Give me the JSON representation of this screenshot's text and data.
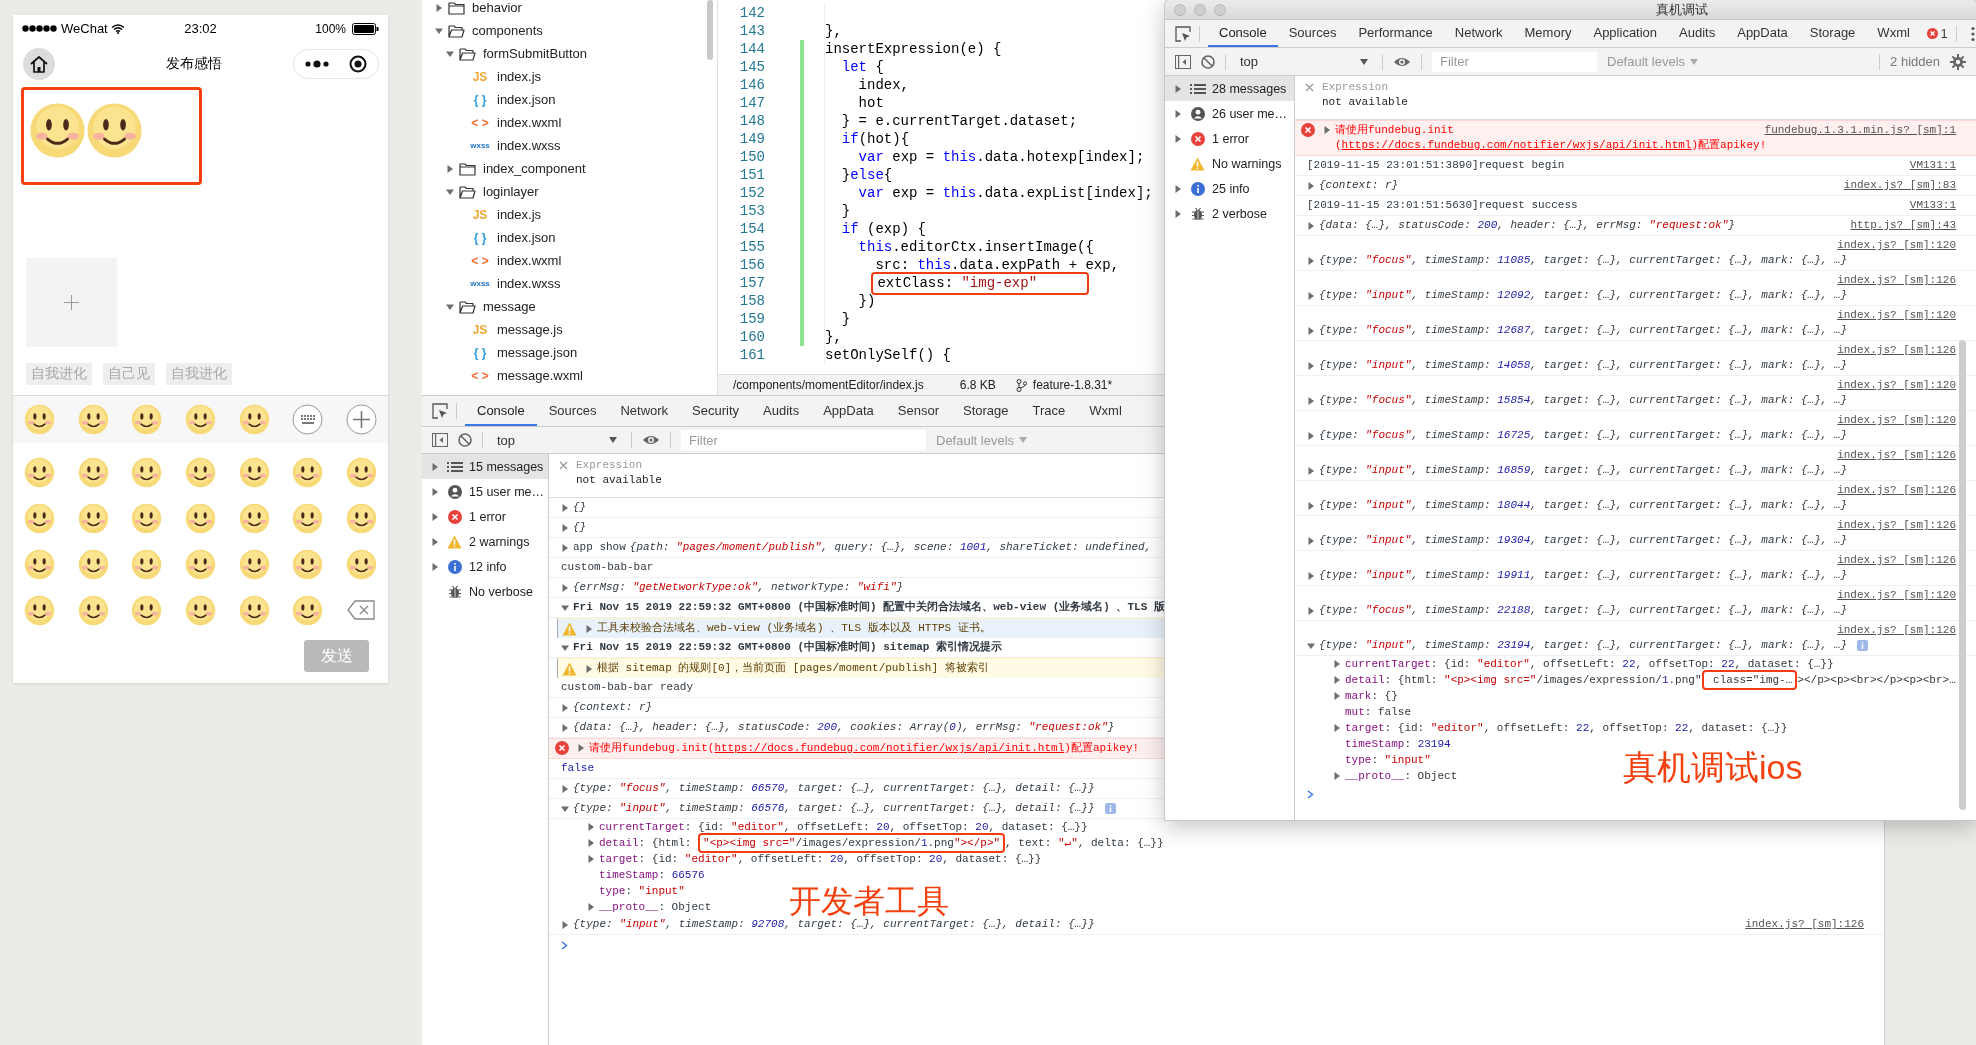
{
  "simulator": {
    "carrier": "WeChat",
    "time": "23:02",
    "battery": "100%",
    "title": "发布感悟",
    "content": [
      {
        "kind": "smiley"
      },
      {
        "kind": "smiley"
      }
    ],
    "tags": [
      "自我进化",
      "自己见",
      "自我进化"
    ],
    "toolbar": [
      {
        "kind": "smiley"
      },
      {
        "kind": "smiley"
      },
      {
        "kind": "smiley"
      },
      {
        "kind": "smiley"
      },
      {
        "kind": "smiley"
      },
      {
        "kind": "keyboard"
      },
      {
        "kind": "add"
      }
    ],
    "emojis": [
      {
        "kind": "smiley"
      },
      {
        "kind": "smiley"
      },
      {
        "kind": "smiley"
      },
      {
        "kind": "smiley"
      },
      {
        "kind": "smiley"
      },
      {
        "kind": "smiley"
      },
      {
        "kind": "smiley"
      },
      {
        "kind": "smiley"
      },
      {
        "kind": "smiley"
      },
      {
        "kind": "smiley"
      },
      {
        "kind": "smiley"
      },
      {
        "kind": "smiley"
      },
      {
        "kind": "smiley"
      },
      {
        "kind": "smiley"
      },
      {
        "kind": "smiley"
      },
      {
        "kind": "smiley"
      },
      {
        "kind": "smiley"
      },
      {
        "kind": "smiley"
      },
      {
        "kind": "smiley"
      },
      {
        "kind": "smiley"
      },
      {
        "kind": "smiley"
      },
      {
        "kind": "smiley"
      },
      {
        "kind": "smiley"
      },
      {
        "kind": "smiley"
      },
      {
        "kind": "smiley"
      },
      {
        "kind": "smiley"
      },
      {
        "kind": "smiley"
      },
      {
        "kind": "delete"
      }
    ],
    "send_button": {
      "label": "发送",
      "disabled": true
    }
  },
  "explorer": {
    "items": [
      {
        "label": "behavior",
        "kind": "folder",
        "expanded": false
      },
      {
        "label": "components",
        "kind": "folder",
        "expanded": true,
        "children": [
          {
            "label": "formSubmitButton",
            "kind": "folder",
            "expanded": true,
            "children": [
              {
                "label": "index.js",
                "kind": "js",
                "icon": "JS"
              },
              {
                "label": "index.json",
                "kind": "json",
                "icon": "{ }"
              },
              {
                "label": "index.wxml",
                "kind": "wxml",
                "icon": "< >"
              },
              {
                "label": "index.wxss",
                "kind": "wxss",
                "icon": "wxss"
              }
            ]
          },
          {
            "label": "index_component",
            "kind": "folder",
            "expanded": false
          },
          {
            "label": "loginlayer",
            "kind": "folder",
            "expanded": true,
            "children": [
              {
                "label": "index.js",
                "kind": "js",
                "icon": "JS"
              },
              {
                "label": "index.json",
                "kind": "json",
                "icon": "{ }"
              },
              {
                "label": "index.wxml",
                "kind": "wxml",
                "icon": "< >"
              },
              {
                "label": "index.wxss",
                "kind": "wxss",
                "icon": "wxss"
              }
            ]
          },
          {
            "label": "message",
            "kind": "folder",
            "expanded": true,
            "children": [
              {
                "label": "message.js",
                "kind": "js",
                "icon": "JS"
              },
              {
                "label": "message.json",
                "kind": "json",
                "icon": "{ }"
              },
              {
                "label": "message.wxml",
                "kind": "wxml",
                "icon": "< >"
              }
            ]
          }
        ]
      }
    ]
  },
  "editor": {
    "lines": [
      {
        "num": "142",
        "changed": false
      },
      {
        "num": "143",
        "changed": false,
        "parts": [
          {
            "text": "},"
          }
        ]
      },
      {
        "num": "144",
        "changed": true,
        "parts": [
          {
            "text": "insertExpression(e) {"
          }
        ]
      },
      {
        "num": "145",
        "changed": true,
        "parts": [
          {
            "kind": "keyword",
            "text": "  let"
          },
          {
            "text": " {"
          }
        ]
      },
      {
        "num": "146",
        "changed": true,
        "parts": [
          {
            "text": "    index,"
          }
        ]
      },
      {
        "num": "147",
        "changed": true,
        "parts": [
          {
            "text": "    hot"
          }
        ]
      },
      {
        "num": "148",
        "changed": true,
        "parts": [
          {
            "text": "  } = e.currentTarget.dataset;"
          }
        ]
      },
      {
        "num": "149",
        "changed": true,
        "parts": [
          {
            "kind": "keyword",
            "text": "  if"
          },
          {
            "text": "(hot){"
          }
        ]
      },
      {
        "num": "150",
        "changed": true,
        "parts": [
          {
            "kind": "keyword",
            "text": "    var"
          },
          {
            "text": " exp = "
          },
          {
            "kind": "keyword",
            "text": "this"
          },
          {
            "text": ".data.hotexp[index];"
          }
        ]
      },
      {
        "num": "151",
        "changed": true,
        "parts": [
          {
            "text": "  }"
          },
          {
            "kind": "keyword",
            "text": "else"
          },
          {
            "text": "{"
          }
        ]
      },
      {
        "num": "152",
        "changed": true,
        "parts": [
          {
            "kind": "keyword",
            "text": "    var"
          },
          {
            "text": " exp = "
          },
          {
            "kind": "keyword",
            "text": "this"
          },
          {
            "text": ".data.expList[index];"
          }
        ]
      },
      {
        "num": "153",
        "changed": true,
        "parts": [
          {
            "text": "  }"
          }
        ]
      },
      {
        "num": "154",
        "changed": true,
        "parts": [
          {
            "kind": "keyword",
            "text": "  if"
          },
          {
            "text": " (exp) {"
          }
        ]
      },
      {
        "num": "155",
        "changed": true,
        "parts": [
          {
            "kind": "keyword",
            "text": "    this"
          },
          {
            "text": ".editorCtx.insertImage({"
          }
        ]
      },
      {
        "num": "156",
        "changed": true,
        "parts": [
          {
            "text": "      src: "
          },
          {
            "kind": "keyword",
            "text": "this"
          },
          {
            "text": ".data.expPath + exp,"
          }
        ]
      },
      {
        "num": "157",
        "changed": true,
        "annotated": true,
        "parts": [
          {
            "text": "      extClass: "
          },
          {
            "kind": "string",
            "text": "\"img-exp\""
          }
        ]
      },
      {
        "num": "158",
        "changed": true,
        "parts": [
          {
            "text": "    })"
          }
        ]
      },
      {
        "num": "159",
        "changed": true,
        "parts": [
          {
            "text": "  }"
          }
        ]
      },
      {
        "num": "160",
        "changed": true,
        "parts": [
          {
            "text": "},"
          }
        ]
      },
      {
        "num": "161",
        "changed": false,
        "parts": [
          {
            "text": "setOnlySelf() {"
          }
        ]
      }
    ],
    "status": {
      "path": "/components/momentEditor/index.js",
      "size": "6.8 KB",
      "branch": "feature-1.8.31*"
    }
  },
  "devtools": {
    "tabs": [
      {
        "label": "Console",
        "selected": true
      },
      {
        "label": "Sources",
        "selected": false
      },
      {
        "label": "Network",
        "selected": false
      },
      {
        "label": "Security",
        "selected": false
      },
      {
        "label": "Audits",
        "selected": false
      },
      {
        "label": "AppData",
        "selected": false
      },
      {
        "label": "Sensor",
        "selected": false
      },
      {
        "label": "Storage",
        "selected": false
      },
      {
        "label": "Trace",
        "selected": false
      },
      {
        "label": "Wxml",
        "selected": false
      }
    ],
    "context": "top",
    "filter_placeholder": "Filter",
    "levels": "Default levels",
    "sidebar": [
      {
        "label": "15 messages",
        "kind": "messages",
        "expandable": true,
        "selected": true
      },
      {
        "label": "15 user me…",
        "kind": "user",
        "expandable": true,
        "selected": false
      },
      {
        "label": "1 error",
        "kind": "error",
        "expandable": true,
        "selected": false
      },
      {
        "label": "2 warnings",
        "kind": "warning",
        "expandable": true,
        "selected": false
      },
      {
        "label": "12 info",
        "kind": "info",
        "expandable": true,
        "selected": false
      },
      {
        "label": "No verbose",
        "kind": "verbose",
        "expandable": false,
        "selected": false
      }
    ],
    "expression": {
      "label": "Expression",
      "value": "not available"
    },
    "rows": [
      {
        "kind": "object",
        "expanded": false,
        "text": "{}"
      },
      {
        "kind": "object",
        "expanded": false,
        "text": "{}"
      },
      {
        "kind": "object",
        "prefix": "app show",
        "expanded": false,
        "text": "{path: \"pages/moment/publish\", query: {…}, scene: 1001, shareTicket: undefined,"
      },
      {
        "kind": "text",
        "text": "custom-bab-bar"
      },
      {
        "kind": "object",
        "expanded": false,
        "text": "{errMsg: \"getNetworkType:ok\", networkType: \"wifi\"}"
      },
      {
        "kind": "group",
        "expanded": true,
        "text": "Fri Nov 15 2019 22:59:32 GMT+0800 (中国标准时间) 配置中关闭合法域名、web-view (业务域名) 、TLS 版",
        "children": [
          {
            "kind": "warning",
            "expanded": false,
            "highlighted": true,
            "text": "工具未校验合法域名、web-view (业务域名) 、TLS 版本以及 HTTPS 证书。"
          }
        ]
      },
      {
        "kind": "group",
        "expanded": true,
        "text": "Fri Nov 15 2019 22:59:32 GMT+0800 (中国标准时间) sitemap 索引情况提示",
        "children": [
          {
            "kind": "warning",
            "expanded": false,
            "highlighted": false,
            "text": "根据 sitemap 的规则[0]，当前页面 [pages/moment/publish] 将被索引"
          }
        ]
      },
      {
        "kind": "text",
        "text": "custom-bab-bar ready"
      },
      {
        "kind": "object",
        "expanded": false,
        "text": "{context: r}"
      },
      {
        "kind": "object",
        "expanded": false,
        "text": "{data: {…}, header: {…}, statusCode: 200, cookies: Array(0), errMsg: \"request:ok\"}"
      },
      {
        "kind": "error",
        "expanded": false,
        "text": "请使用fundebug.init(",
        "link": "https://docs.fundebug.com/notifier/wxjs/api/init.html",
        "text_after": ")配置apikey!"
      },
      {
        "kind": "value",
        "text": "false"
      },
      {
        "kind": "object",
        "expanded": false,
        "text": "{type: \"focus\", timeStamp: 66570, target: {…}, currentTarget: {…}, detail: {…}}"
      },
      {
        "kind": "object",
        "expanded": true,
        "info": true,
        "text": "{type: \"input\", timeStamp: 66576, target: {…}, currentTarget: {…}, detail: {…}}",
        "children": [
          {
            "kind": "prop",
            "expanded": false,
            "text": "currentTarget: {id: \"editor\", offsetLeft: 20, offsetTop: 20, dataset: {…}}"
          },
          {
            "kind": "prop",
            "expanded": false,
            "text": "detail: {html: ",
            "annotated": "\"<p><img src=\"/images/expression/1.png\"></p>\"",
            "text_after": ", text: \"↵\", delta: {…}}"
          },
          {
            "kind": "prop",
            "expanded": false,
            "text": "target: {id: \"editor\", offsetLeft: 20, offsetTop: 20, dataset: {…}}"
          },
          {
            "kind": "prop",
            "text": "timeStamp: 66576"
          },
          {
            "kind": "prop",
            "text": "type: \"input\""
          },
          {
            "kind": "prop",
            "expanded": false,
            "text": "__proto__: Object"
          }
        ]
      },
      {
        "kind": "object",
        "expanded": false,
        "text": "{type: \"input\", timeStamp: 92708, target: {…}, currentTarget: {…}, detail: {…}}",
        "source": "index.js? [sm]:126"
      }
    ],
    "annotation": "开发者工具"
  },
  "device_window": {
    "title": "真机调试",
    "tabs": [
      {
        "label": "Console",
        "selected": true
      },
      {
        "label": "Sources",
        "selected": false
      },
      {
        "label": "Performance",
        "selected": false
      },
      {
        "label": "Network",
        "selected": false
      },
      {
        "label": "Memory",
        "selected": false
      },
      {
        "label": "Application",
        "selected": false
      },
      {
        "label": "Audits",
        "selected": false
      },
      {
        "label": "AppData",
        "selected": false
      },
      {
        "label": "Storage",
        "selected": false
      },
      {
        "label": "Wxml",
        "selected": false
      }
    ],
    "error_count": "1",
    "context": "top",
    "filter_placeholder": "Filter",
    "levels": "Default levels",
    "hidden": "2 hidden",
    "sidebar": [
      {
        "label": "28 messages",
        "kind": "messages",
        "expandable": true,
        "selected": true
      },
      {
        "label": "26 user me…",
        "kind": "user",
        "expandable": true,
        "selected": false
      },
      {
        "label": "1 error",
        "kind": "error",
        "expandable": true,
        "selected": false
      },
      {
        "label": "No warnings",
        "kind": "warning",
        "expandable": false,
        "selected": false
      },
      {
        "label": "25 info",
        "kind": "info",
        "expandable": true,
        "selected": false
      },
      {
        "label": "2 verbose",
        "kind": "verbose",
        "expandable": true,
        "selected": false
      }
    ],
    "expression": {
      "label": "Expression",
      "value": "not available"
    },
    "rows": [
      {
        "kind": "error",
        "expanded": false,
        "text": "请使用fundebug.init(",
        "link": "https://docs.fundebug.com/notifier/wxjs/api/init.html",
        "text_after": ")配置apikey!",
        "source": "fundebug.1.3.1.min.js? [sm]:1"
      },
      {
        "kind": "text",
        "text": "[2019-11-15 23:01:51:3890]request begin",
        "source": "VM131:1"
      },
      {
        "kind": "object",
        "expanded": false,
        "text": "{context: r}",
        "source": "index.js? [sm]:83"
      },
      {
        "kind": "text",
        "text": "[2019-11-15 23:01:51:5630]request success",
        "source": "VM133:1"
      },
      {
        "kind": "object",
        "expanded": false,
        "text": "{data: {…}, statusCode: 200, header: {…}, errMsg: \"request:ok\"}",
        "source": "http.js? [sm]:43"
      },
      {
        "kind": "object",
        "expanded": false,
        "text": "{type: \"focus\", timeStamp: 11085, target: {…}, currentTarget: {…}, mark: {…}, …}",
        "source": "index.js? [sm]:120"
      },
      {
        "kind": "object",
        "expanded": false,
        "text": "{type: \"input\", timeStamp: 12092, target: {…}, currentTarget: {…}, mark: {…}, …}",
        "source": "index.js? [sm]:126"
      },
      {
        "kind": "object",
        "expanded": false,
        "text": "{type: \"focus\", timeStamp: 12687, target: {…}, currentTarget: {…}, mark: {…}, …}",
        "source": "index.js? [sm]:120"
      },
      {
        "kind": "object",
        "expanded": false,
        "text": "{type: \"input\", timeStamp: 14058, target: {…}, currentTarget: {…}, mark: {…}, …}",
        "source": "index.js? [sm]:126"
      },
      {
        "kind": "object",
        "expanded": false,
        "text": "{type: \"focus\", timeStamp: 15854, target: {…}, currentTarget: {…}, mark: {…}, …}",
        "source": "index.js? [sm]:120"
      },
      {
        "kind": "object",
        "expanded": false,
        "text": "{type: \"focus\", timeStamp: 16725, target: {…}, currentTarget: {…}, mark: {…}, …}",
        "source": "index.js? [sm]:120"
      },
      {
        "kind": "object",
        "expanded": false,
        "text": "{type: \"input\", timeStamp: 16859, target: {…}, currentTarget: {…}, mark: {…}, …}",
        "source": "index.js? [sm]:126"
      },
      {
        "kind": "object",
        "expanded": false,
        "text": "{type: \"input\", timeStamp: 18044, target: {…}, currentTarget: {…}, mark: {…}, …}",
        "source": "index.js? [sm]:126"
      },
      {
        "kind": "object",
        "expanded": false,
        "text": "{type: \"input\", timeStamp: 19304, target: {…}, currentTarget: {…}, mark: {…}, …}",
        "source": "index.js? [sm]:126"
      },
      {
        "kind": "object",
        "expanded": false,
        "text": "{type: \"input\", timeStamp: 19911, target: {…}, currentTarget: {…}, mark: {…}, …}",
        "source": "index.js? [sm]:126"
      },
      {
        "kind": "object",
        "expanded": false,
        "text": "{type: \"focus\", timeStamp: 22188, target: {…}, currentTarget: {…}, mark: {…}, …}",
        "source": "index.js? [sm]:120"
      },
      {
        "kind": "object",
        "expanded": true,
        "info": true,
        "text": "{type: \"input\", timeStamp: 23194, target: {…}, currentTarget: {…}, mark: {…}, …}",
        "source": "index.js? [sm]:126",
        "children": [
          {
            "kind": "prop",
            "expanded": false,
            "text": "currentTarget: {id: \"editor\", offsetLeft: 22, offsetTop: 22, dataset: {…}}"
          },
          {
            "kind": "prop",
            "expanded": false,
            "text": "detail: {html: \"<p><img src=\"/images/expression/1.png\"",
            "annotated": " class=\"img-…",
            "text_after": "></p><p><br></p><p><br>…"
          },
          {
            "kind": "prop",
            "expanded": false,
            "text": "mark: {}"
          },
          {
            "kind": "prop",
            "text": "mut: false"
          },
          {
            "kind": "prop",
            "expanded": false,
            "text": "target: {id: \"editor\", offsetLeft: 22, offsetTop: 22, dataset: {…}}"
          },
          {
            "kind": "prop",
            "text": "timeStamp: 23194"
          },
          {
            "kind": "prop",
            "text": "type: \"input\""
          },
          {
            "kind": "prop",
            "expanded": false,
            "text": "__proto__: Object"
          }
        ]
      }
    ],
    "annotation": "真机调试ios"
  }
}
